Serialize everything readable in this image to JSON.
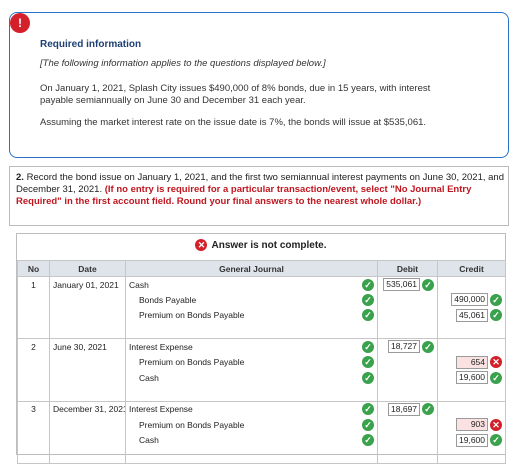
{
  "info": {
    "title": "Required information",
    "note": "[The following information applies to the questions displayed below.]",
    "para1": "On January 1, 2021, Splash City issues $490,000 of 8% bonds, due in 15 years, with interest payable semiannually on June 30 and December 31 each year.",
    "para2": "Assuming the market interest rate on the issue date is 7%, the bonds will issue at $535,061."
  },
  "question": {
    "num": "2.",
    "text": "Record the bond issue on January 1, 2021, and the first two semiannual interest payments on June 30, 2021, and December 31, 2021.",
    "instruction": "(If no entry is required for a particular transaction/event, select \"No Journal Entry Required\" in the first account field. Round your final answers to the nearest whole dollar.)"
  },
  "journal": {
    "status": "Answer is not complete.",
    "headers": {
      "no": "No",
      "date": "Date",
      "account": "General Journal",
      "debit": "Debit",
      "credit": "Credit"
    },
    "rows": [
      {
        "no": "1",
        "date": "January 01, 2021",
        "account": "Cash",
        "debit": "535,061",
        "credit": "",
        "debit_ok": true
      },
      {
        "no": "",
        "date": "",
        "account": "Bonds Payable",
        "debit": "",
        "credit": "490,000",
        "credit_ok": true
      },
      {
        "no": "",
        "date": "",
        "account": "Premium on Bonds Payable",
        "debit": "",
        "credit": "45,061",
        "credit_ok": true
      },
      {
        "no": "2",
        "date": "June 30, 2021",
        "account": "Interest Expense",
        "debit": "18,727",
        "credit": "",
        "debit_ok": true
      },
      {
        "no": "",
        "date": "",
        "account": "Premium on Bonds Payable",
        "debit": "",
        "credit": "654",
        "credit_ok": false
      },
      {
        "no": "",
        "date": "",
        "account": "Cash",
        "debit": "",
        "credit": "19,600",
        "credit_ok": true
      },
      {
        "no": "3",
        "date": "December 31, 2021",
        "account": "Interest Expense",
        "debit": "18,697",
        "credit": "",
        "debit_ok": true
      },
      {
        "no": "",
        "date": "",
        "account": "Premium on Bonds Payable",
        "debit": "",
        "credit": "903",
        "credit_ok": false
      },
      {
        "no": "",
        "date": "",
        "account": "Cash",
        "debit": "",
        "credit": "19,600",
        "credit_ok": true
      }
    ]
  },
  "colors": {
    "accent": "#2a72c9",
    "error": "#d3202a",
    "success": "#3aa14c",
    "header_bg": "#dfe4ea"
  }
}
